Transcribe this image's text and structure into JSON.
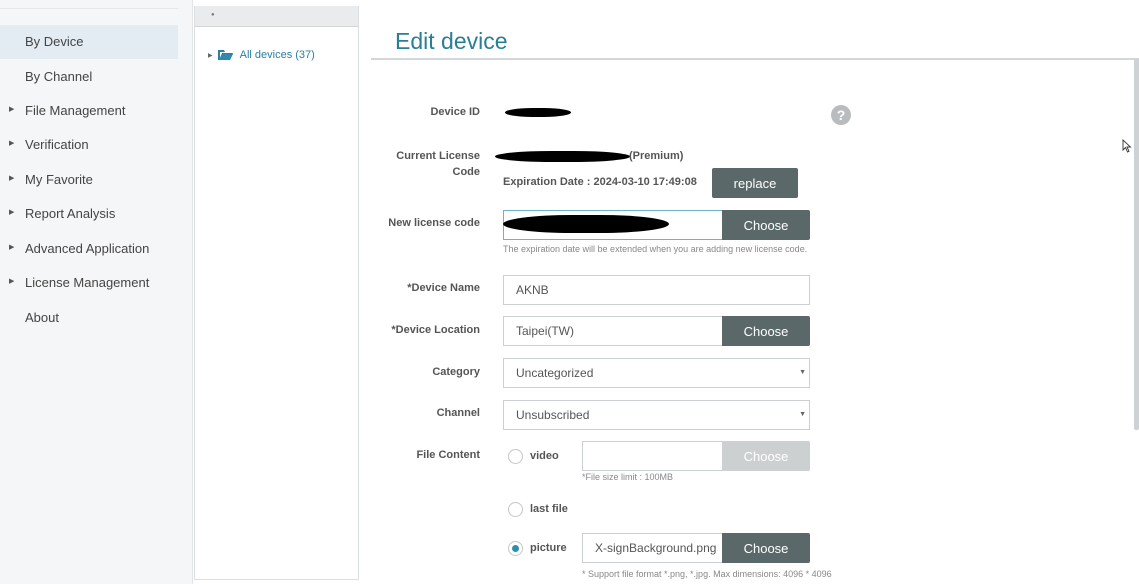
{
  "sidebar": {
    "items": [
      {
        "label": "By Device",
        "active": true,
        "expandable": false
      },
      {
        "label": "By Channel",
        "active": false,
        "expandable": false
      },
      {
        "label": "File Management",
        "active": false,
        "expandable": true
      },
      {
        "label": "Verification",
        "active": false,
        "expandable": true
      },
      {
        "label": "My Favorite",
        "active": false,
        "expandable": true
      },
      {
        "label": "Report Analysis",
        "active": false,
        "expandable": true
      },
      {
        "label": "Advanced Application",
        "active": false,
        "expandable": true
      },
      {
        "label": "License Management",
        "active": false,
        "expandable": true
      },
      {
        "label": "About",
        "active": false,
        "expandable": false
      }
    ]
  },
  "tree": {
    "node_label": "All devices (37)",
    "folder_color": "#2a7fa3"
  },
  "page": {
    "title": "Edit device",
    "accent_color": "#2a7f94"
  },
  "form": {
    "device_id_label": "Device ID",
    "current_license_label": "Current License Code",
    "current_license_suffix": "(Premium)",
    "expiration_text": "Expiration Date : 2024-03-10 17:49:08",
    "replace_button": "replace",
    "new_license_label": "New license code",
    "new_license_choose": "Choose",
    "new_license_hint": "The expiration date will be extended when you are adding new license code.",
    "device_name_label": "*Device Name",
    "device_name_value": "AKNB",
    "device_location_label": "*Device Location",
    "device_location_value": "Taipei(TW)",
    "device_location_choose": "Choose",
    "category_label": "Category",
    "category_value": "Uncategorized",
    "channel_label": "Channel",
    "channel_value": "Unsubscribed",
    "file_content_label": "File Content",
    "option_video": "video",
    "video_choose": "Choose",
    "video_hint": "*File size limit : 100MB",
    "option_last_file": "last file",
    "option_picture": "picture",
    "picture_value": "X-signBackground.png",
    "picture_choose": "Choose",
    "picture_hint": "* Support file format *.png, *.jpg. Max dimensions: 4096 * 4096",
    "selected_option": "picture"
  }
}
